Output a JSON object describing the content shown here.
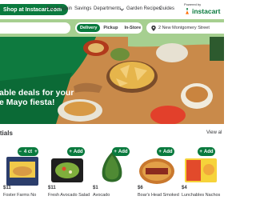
{
  "header": {
    "logo_text": "Shop at Instacart.com",
    "nav": [
      "Buy It Again",
      "Savings",
      "Departments",
      "Garden Recipes",
      "Guides"
    ],
    "powered_by": "Powered by",
    "brand": "instacart"
  },
  "search_row": {
    "toggle": [
      "Delivery",
      "Pickup",
      "In-Store"
    ],
    "active_toggle": "Delivery",
    "address": "2 New Montgomery Street"
  },
  "hero": {
    "lines": [
      "able deals for your",
      "e Mayo fiesta!"
    ]
  },
  "section": {
    "title": "ntials",
    "view_all": "View al"
  },
  "products": [
    {
      "add_label": "4 ct",
      "price": "$11",
      "name": "Foster Farms No"
    },
    {
      "add_label": "Add",
      "price": "$11",
      "name": "Fresh Avocado Salad"
    },
    {
      "add_label": "Add",
      "price": "$1",
      "name": "Avocado"
    },
    {
      "add_label": "Add",
      "price": "$6",
      "name": "Boar's Head Smoked"
    },
    {
      "add_label": "Add",
      "price": "$4",
      "name": "Lunchables Nachos"
    }
  ],
  "colors": {
    "brand_green": "#0a7a3e",
    "search_band": "#a6cf90",
    "table_wood": "#c98a4a"
  }
}
